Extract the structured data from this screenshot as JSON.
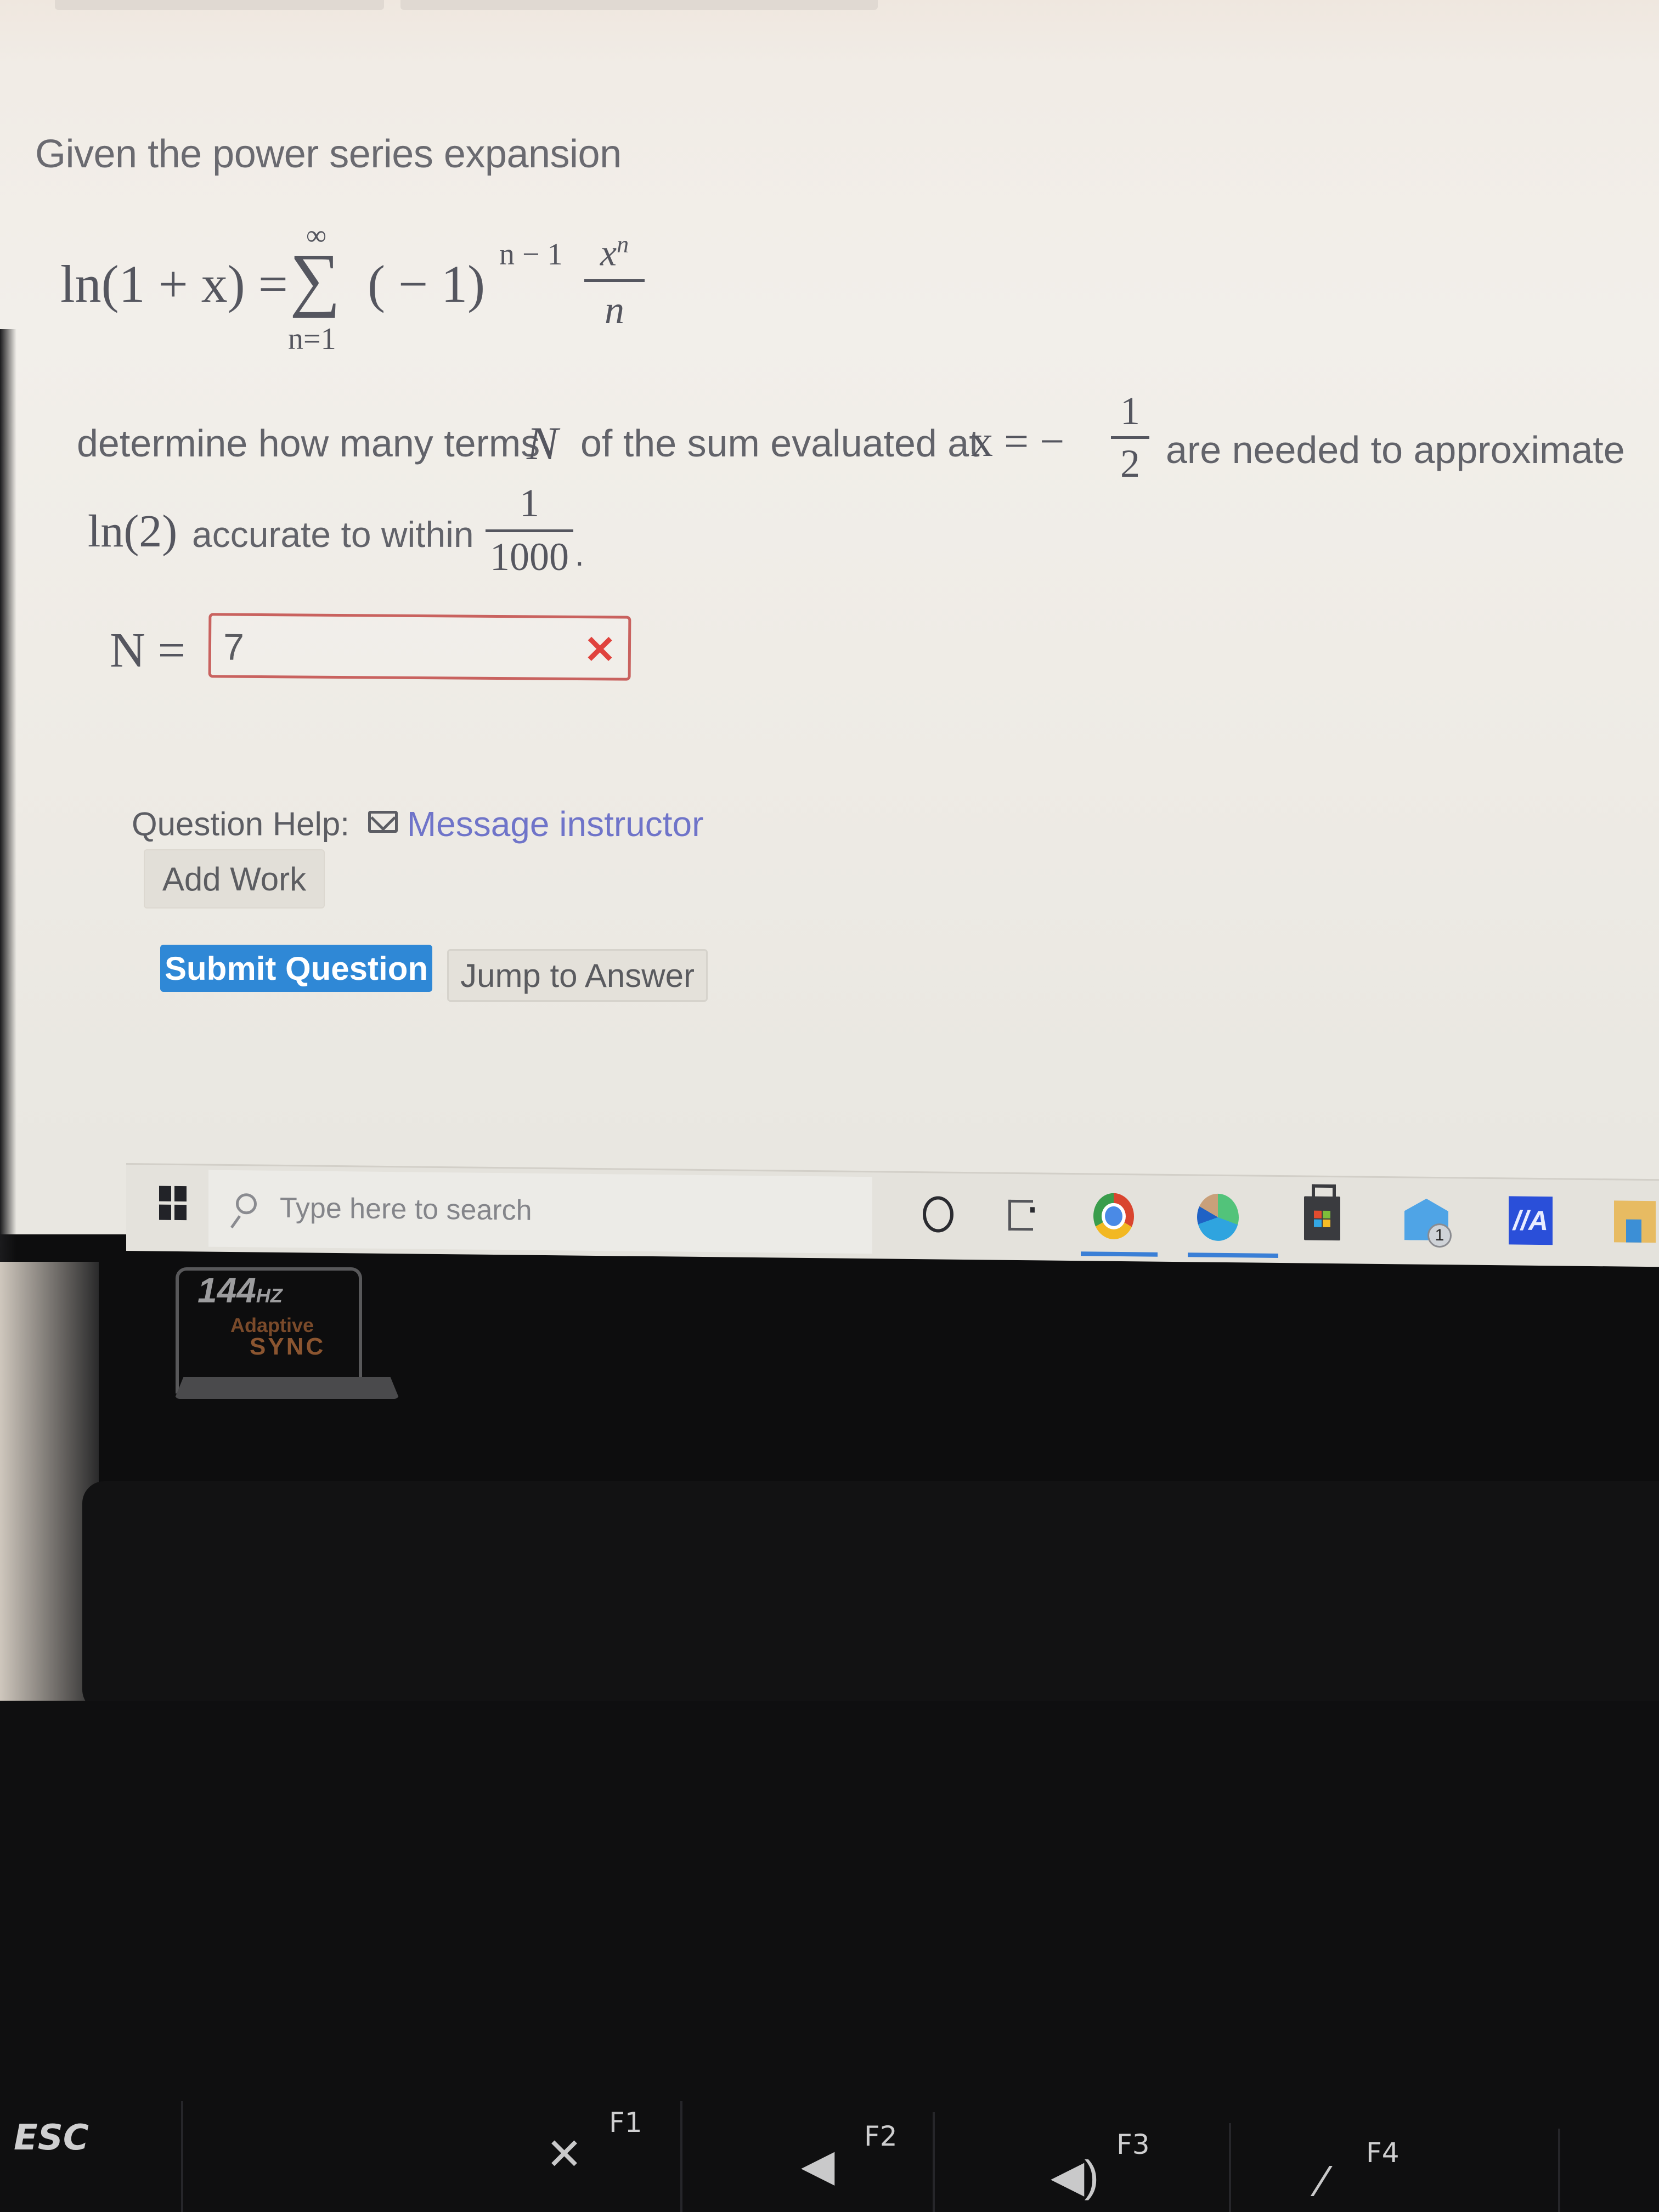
{
  "question": {
    "intro": "Given the power series expansion",
    "formula": {
      "lhs": "ln(1 + x) =",
      "sum_upper": "∞",
      "sum_symbol": "∑",
      "sum_lower": "n=1",
      "term": "( − 1)",
      "exponent": "n − 1",
      "frac_num": "x",
      "frac_num_exp": "n",
      "frac_den": "n"
    },
    "line1_part1": "determine how many terms",
    "line1_var": "N",
    "line1_part2": "of the sum evaluated at",
    "line1_xeq": "x = −",
    "line1_frac_num": "1",
    "line1_frac_den": "2",
    "line1_part3": "are needed to approximate",
    "line2_ln": "ln(2)",
    "line2_text": "accurate to within",
    "line2_frac_num": "1",
    "line2_frac_den": "1000",
    "line2_end": "."
  },
  "answer": {
    "label": "N =",
    "value": "7",
    "status": "incorrect",
    "status_icon": "✕",
    "status_color": "#e0433e"
  },
  "help": {
    "label": "Question Help:",
    "message_link": "Message instructor",
    "add_work": "Add Work"
  },
  "actions": {
    "submit": "Submit Question",
    "jump": "Jump to Answer",
    "submit_color": "#2f88d6"
  },
  "taskbar": {
    "search_placeholder": "Type here to search",
    "apps": [
      {
        "name": "cortana",
        "icon": "circle-icon"
      },
      {
        "name": "task-view",
        "icon": "task-view-icon"
      },
      {
        "name": "chrome",
        "icon": "chrome-icon",
        "active": true
      },
      {
        "name": "edge",
        "icon": "edge-icon",
        "active": true
      },
      {
        "name": "microsoft-store",
        "icon": "store-icon"
      },
      {
        "name": "mail",
        "icon": "mail-icon",
        "badge": "1"
      },
      {
        "name": "mywork",
        "icon": "mywork-icon",
        "label": "//A"
      },
      {
        "name": "file-explorer",
        "icon": "folder-icon"
      }
    ]
  },
  "bezel": {
    "sticker_hz": "144",
    "sticker_hz_unit": "HZ",
    "sticker_line2": "Adaptive",
    "sticker_line3": "SYNC"
  },
  "keyboard": {
    "esc": "ESC",
    "f1": "F1",
    "f2": "F2",
    "f3": "F3",
    "f4": "F4",
    "f1_icon": "🔇",
    "f2_icon": "🔈",
    "f3_icon": "🔊",
    "f4_icon": "🎙"
  }
}
